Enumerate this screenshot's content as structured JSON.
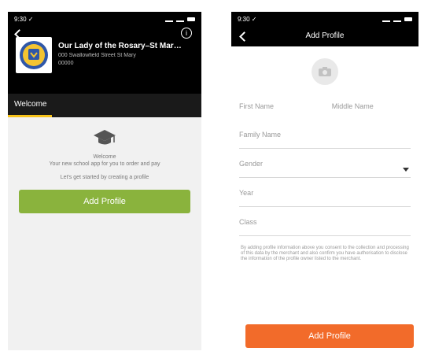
{
  "left": {
    "status_time": "9:30 ✓",
    "school": {
      "name": "Our Lady of the Rosary–St Mar…",
      "address": "000 Swallowfield Street St Mary",
      "extra": "00000"
    },
    "tab_label": "Welcome",
    "welcome": {
      "title": "Welcome",
      "line": "Your new school app for you to order and pay",
      "hint": "Let's get started by creating a profile"
    },
    "add_profile_label": "Add Profile",
    "colors": {
      "accent": "#f6c21a",
      "button": "#8ab33d"
    }
  },
  "right": {
    "status_time": "9:30 ✓",
    "title": "Add Profile",
    "fields": {
      "first_name": "First Name",
      "middle_name": "Middle Name",
      "family_name": "Family Name",
      "gender": "Gender",
      "year": "Year",
      "class": "Class"
    },
    "disclaimer": "By adding profile information above you consent to the collection and processing of this data by the merchant and also confirm you have authorisation to disclose the information of the profile owner listed to the merchant.",
    "add_profile_label": "Add Profile",
    "colors": {
      "button": "#f26b2a"
    }
  }
}
